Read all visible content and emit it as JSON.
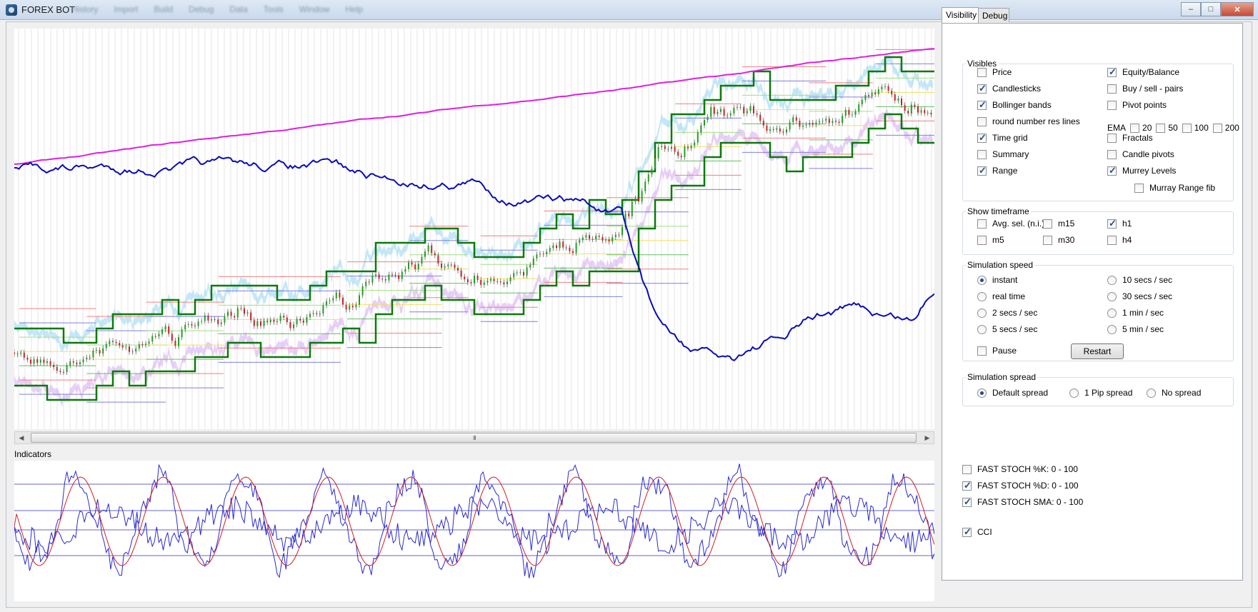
{
  "window": {
    "title": "FOREX BOT",
    "menu": [
      "History",
      "Import",
      "Build",
      "Debug",
      "Data",
      "Tools",
      "Window",
      "Help"
    ],
    "controls": {
      "minimize": "–",
      "maximize": "□",
      "close": "✕"
    }
  },
  "charts": {
    "scroll_grip": "III",
    "scroll_left": "◀",
    "scroll_right": "▶",
    "indicators_label": "Indicators"
  },
  "tabs": [
    {
      "label": "Visibility",
      "active": true
    },
    {
      "label": "Debug",
      "active": false
    }
  ],
  "visibles": {
    "legend": "Visibles",
    "left": [
      {
        "label": "Price",
        "checked": false
      },
      {
        "label": "Candlesticks",
        "checked": true
      },
      {
        "label": "Bollinger bands",
        "checked": true
      },
      {
        "label": "round number res lines",
        "checked": false
      },
      {
        "label": "Time grid",
        "checked": true
      },
      {
        "label": "Summary",
        "checked": false
      },
      {
        "label": "Range",
        "checked": true
      }
    ],
    "right": [
      {
        "label": "Equity/Balance",
        "checked": true
      },
      {
        "label": "Buy / sell - pairs",
        "checked": false
      },
      {
        "label": "Pivot points",
        "checked": false
      },
      {
        "label": "Fractals",
        "checked": false
      },
      {
        "label": "Candle pivots",
        "checked": false
      },
      {
        "label": "Murrey Levels",
        "checked": true
      },
      {
        "label": "Murray Range fib",
        "checked": false
      }
    ],
    "ema": {
      "label": "EMA",
      "options": [
        {
          "label": "20",
          "checked": false
        },
        {
          "label": "50",
          "checked": false
        },
        {
          "label": "100",
          "checked": false
        },
        {
          "label": "200",
          "checked": false
        }
      ]
    }
  },
  "timeframe": {
    "legend": "Show timeframe",
    "options": [
      {
        "label": "Avg. sel. (n.i.)",
        "checked": false
      },
      {
        "label": "m15",
        "checked": false
      },
      {
        "label": "h1",
        "checked": true
      },
      {
        "label": "m5",
        "checked": false
      },
      {
        "label": "m30",
        "checked": false
      },
      {
        "label": "h4",
        "checked": false
      }
    ]
  },
  "speed": {
    "legend": "Simulation speed",
    "left": [
      {
        "label": "instant",
        "selected": true
      },
      {
        "label": "real time",
        "selected": false
      },
      {
        "label": "2 secs / sec",
        "selected": false
      },
      {
        "label": "5 secs / sec",
        "selected": false
      }
    ],
    "right": [
      {
        "label": "10 secs / sec",
        "selected": false
      },
      {
        "label": "30 secs / sec",
        "selected": false
      },
      {
        "label": "1 min / sec",
        "selected": false
      },
      {
        "label": "5 min / sec",
        "selected": false
      }
    ],
    "pause": {
      "label": "Pause",
      "checked": false
    },
    "restart_label": "Restart"
  },
  "spread": {
    "legend": "Simulation spread",
    "options": [
      {
        "label": "Default spread",
        "selected": true
      },
      {
        "label": "1 Pip spread",
        "selected": false
      },
      {
        "label": "No spread",
        "selected": false
      }
    ]
  },
  "indicator_options": [
    {
      "label": "FAST STOCH %K: 0 - 100",
      "checked": false
    },
    {
      "label": "FAST STOCH %D: 0 - 100",
      "checked": true
    },
    {
      "label": "FAST STOCH SMA:  0 - 100",
      "checked": true
    },
    {
      "label": "CCI",
      "checked": true
    }
  ],
  "colors": {
    "equity": "#e01ee0",
    "balance": "#0b0bb8",
    "murrey": "#0a7a0a",
    "bollinger_upper": "#9fd8f5",
    "bollinger_lower": "#d8b0f5",
    "stoch_d": "#2a2ad0",
    "stoch_sma": "#d02020"
  }
}
